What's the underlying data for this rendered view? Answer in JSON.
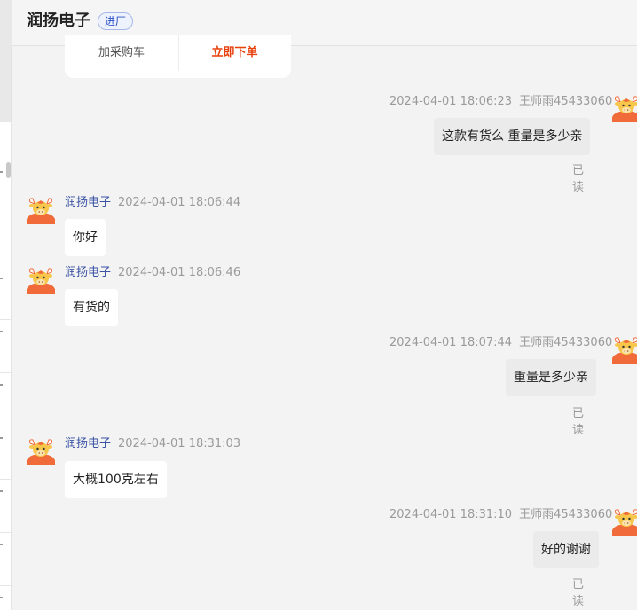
{
  "header": {
    "shop_name": "润扬电子",
    "badge": "进厂"
  },
  "product_card": {
    "add_cart": "加采购车",
    "order_now": "立即下单"
  },
  "messages": [
    {
      "side": "right",
      "time": "2024-04-01 18:06:23",
      "sender": "王师雨45433060",
      "text": "这款有货么 重量是多少亲",
      "status": "已读"
    },
    {
      "side": "left",
      "sender": "润扬电子",
      "time": "2024-04-01 18:06:44",
      "text": "你好"
    },
    {
      "side": "left",
      "sender": "润扬电子",
      "time": "2024-04-01 18:06:46",
      "text": "有货的"
    },
    {
      "side": "right",
      "time": "2024-04-01 18:07:44",
      "sender": "王师雨45433060",
      "text": "重量是多少亲",
      "status": "已读"
    },
    {
      "side": "left",
      "sender": "润扬电子",
      "time": "2024-04-01 18:31:03",
      "text": "大概100克左右"
    },
    {
      "side": "right",
      "time": "2024-04-01 18:31:10",
      "sender": "王师雨45433060",
      "text": "好的谢谢",
      "status": "已读"
    }
  ],
  "colors": {
    "accent_order": "#e8400c",
    "sender_name": "#3a53a4",
    "badge_text": "#2b54c6",
    "avatar_body": "#f06a3a",
    "avatar_face": "#f7c64a"
  },
  "icons": {
    "avatar": "cartoon-bull-avatar-icon"
  }
}
